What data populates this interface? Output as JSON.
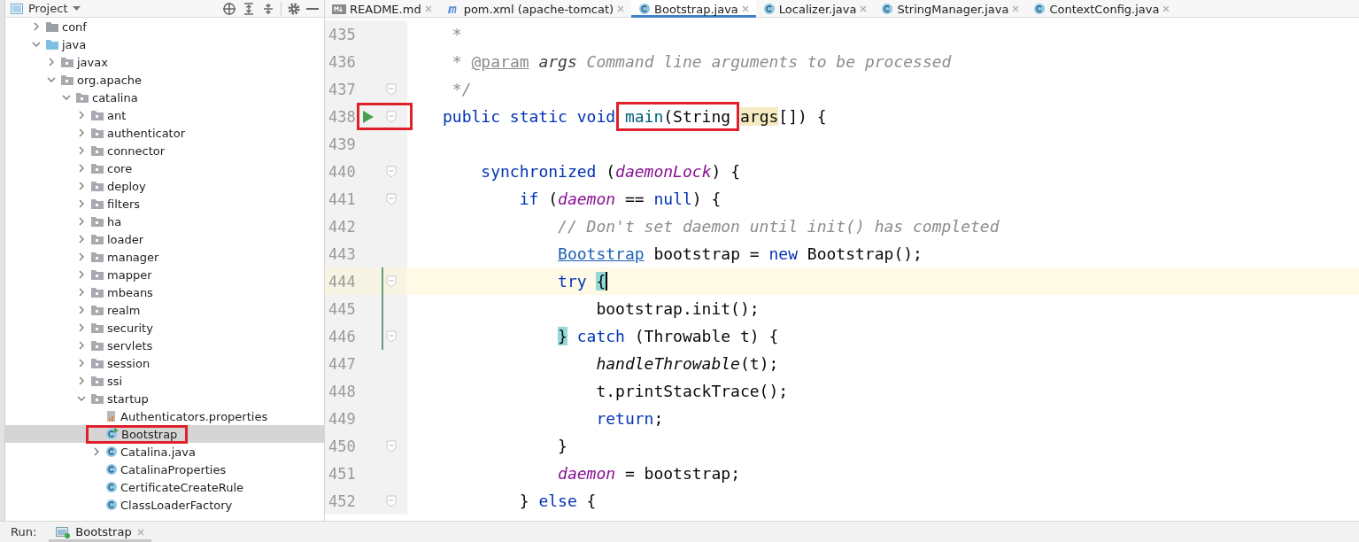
{
  "project_panel": {
    "title": "Project"
  },
  "tree": [
    {
      "label": "conf",
      "kind": "folder",
      "expanded": false
    },
    {
      "label": "java",
      "kind": "source-folder",
      "expanded": true,
      "children": [
        {
          "label": "javax",
          "kind": "package",
          "expanded": false
        },
        {
          "label": "org.apache",
          "kind": "package",
          "expanded": true,
          "children": [
            {
              "label": "catalina",
              "kind": "package",
              "expanded": true,
              "children": [
                {
                  "label": "ant",
                  "kind": "package",
                  "expanded": false
                },
                {
                  "label": "authenticator",
                  "kind": "package",
                  "expanded": false
                },
                {
                  "label": "connector",
                  "kind": "package",
                  "expanded": false
                },
                {
                  "label": "core",
                  "kind": "package",
                  "expanded": false
                },
                {
                  "label": "deploy",
                  "kind": "package",
                  "expanded": false
                },
                {
                  "label": "filters",
                  "kind": "package",
                  "expanded": false
                },
                {
                  "label": "ha",
                  "kind": "package",
                  "expanded": false
                },
                {
                  "label": "loader",
                  "kind": "package",
                  "expanded": false
                },
                {
                  "label": "manager",
                  "kind": "package",
                  "expanded": false
                },
                {
                  "label": "mapper",
                  "kind": "package",
                  "expanded": false
                },
                {
                  "label": "mbeans",
                  "kind": "package",
                  "expanded": false
                },
                {
                  "label": "realm",
                  "kind": "package",
                  "expanded": false
                },
                {
                  "label": "security",
                  "kind": "package",
                  "expanded": false
                },
                {
                  "label": "servlets",
                  "kind": "package",
                  "expanded": false
                },
                {
                  "label": "session",
                  "kind": "package",
                  "expanded": false
                },
                {
                  "label": "ssi",
                  "kind": "package",
                  "expanded": false
                },
                {
                  "label": "startup",
                  "kind": "package",
                  "expanded": true,
                  "children": [
                    {
                      "label": "Authenticators.properties",
                      "kind": "properties"
                    },
                    {
                      "label": "Bootstrap",
                      "kind": "runnable-class",
                      "selected": true,
                      "boxed": true
                    },
                    {
                      "label": "Catalina.java",
                      "kind": "class",
                      "expanded": false
                    },
                    {
                      "label": "CatalinaProperties",
                      "kind": "class"
                    },
                    {
                      "label": "CertificateCreateRule",
                      "kind": "class"
                    },
                    {
                      "label": "ClassLoaderFactory",
                      "kind": "class"
                    }
                  ]
                }
              ]
            }
          ]
        }
      ]
    }
  ],
  "editor_tabs": [
    {
      "label": "README.md",
      "kind": "md",
      "selected": false
    },
    {
      "label": "pom.xml (apache-tomcat)",
      "kind": "maven",
      "selected": false
    },
    {
      "label": "Bootstrap.java",
      "kind": "class",
      "selected": true
    },
    {
      "label": "Localizer.java",
      "kind": "class",
      "selected": false
    },
    {
      "label": "StringManager.java",
      "kind": "class",
      "selected": false
    },
    {
      "label": "ContextConfig.java",
      "kind": "class",
      "selected": false
    }
  ],
  "code_lines": [
    {
      "number": "435",
      "tokens": [
        {
          "kind": "comment",
          "text": " *"
        }
      ]
    },
    {
      "number": "436",
      "tokens": [
        {
          "kind": "comment",
          "text": " * "
        },
        {
          "kind": "doctag",
          "text": "@param"
        },
        {
          "kind": "docparam",
          "text": " args"
        },
        {
          "kind": "comment",
          "text": " Command line arguments to be processed"
        }
      ]
    },
    {
      "number": "437",
      "fold": true,
      "tokens": [
        {
          "kind": "comment",
          "text": " */"
        }
      ]
    },
    {
      "number": "438",
      "fold": true,
      "run": true,
      "boxed": true,
      "tokens": [
        {
          "kind": "kw",
          "text": "public static void "
        },
        {
          "kind": "decl",
          "text": "main",
          "boxed": true
        },
        {
          "kind": "plain",
          "text": "(String",
          "boxed": true
        },
        {
          "kind": "param-hl",
          "text": " args"
        },
        {
          "kind": "plain",
          "text": "[]) {"
        }
      ]
    },
    {
      "number": "439"
    },
    {
      "number": "440",
      "fold": true,
      "tokens": [
        {
          "kind": "kw",
          "text": "    synchronized"
        },
        {
          "kind": "plain",
          "text": " ("
        },
        {
          "kind": "field",
          "text": "daemonLock"
        },
        {
          "kind": "plain",
          "text": ") {"
        }
      ]
    },
    {
      "number": "441",
      "fold": true,
      "tokens": [
        {
          "kind": "kw",
          "text": "        if"
        },
        {
          "kind": "plain",
          "text": " ("
        },
        {
          "kind": "field",
          "text": "daemon"
        },
        {
          "kind": "plain",
          "text": " == "
        },
        {
          "kind": "kw",
          "text": "null"
        },
        {
          "kind": "plain",
          "text": ") {"
        }
      ]
    },
    {
      "number": "442",
      "tokens": [
        {
          "kind": "comment",
          "text": "            // Don't set daemon until init() has completed"
        }
      ]
    },
    {
      "number": "443",
      "tokens": [
        {
          "kind": "link",
          "text": "            Bootstrap"
        },
        {
          "kind": "plain",
          "text": " bootstrap = "
        },
        {
          "kind": "kw",
          "text": "new"
        },
        {
          "kind": "plain",
          "text": " Bootstrap();"
        }
      ]
    },
    {
      "number": "444",
      "fold": true,
      "current": true,
      "changed": true,
      "tokens": [
        {
          "kind": "kw",
          "text": "            try"
        },
        {
          "kind": "brace-match",
          "text": " {",
          "caret": true
        }
      ]
    },
    {
      "number": "445",
      "changed": true,
      "tokens": [
        {
          "kind": "plain",
          "text": "                bootstrap.init();"
        }
      ]
    },
    {
      "number": "446",
      "fold": true,
      "changed": true,
      "tokens": [
        {
          "kind": "brace-match",
          "text": "            }"
        },
        {
          "kind": "kw",
          "text": " catch"
        },
        {
          "kind": "plain",
          "text": " (Throwable t) {"
        }
      ]
    },
    {
      "number": "447",
      "tokens": [
        {
          "kind": "static-call",
          "text": "                handleThrowable"
        },
        {
          "kind": "plain",
          "text": "(t);"
        }
      ]
    },
    {
      "number": "448",
      "tokens": [
        {
          "kind": "plain",
          "text": "                t.printStackTrace();"
        }
      ]
    },
    {
      "number": "449",
      "tokens": [
        {
          "kind": "kw",
          "text": "                return"
        },
        {
          "kind": "plain",
          "text": ";"
        }
      ]
    },
    {
      "number": "450",
      "fold": true,
      "tokens": [
        {
          "kind": "plain",
          "text": "            }"
        }
      ]
    },
    {
      "number": "451",
      "tokens": [
        {
          "kind": "field",
          "text": "            daemon"
        },
        {
          "kind": "plain",
          "text": " = bootstrap;"
        }
      ]
    },
    {
      "number": "452",
      "fold": true,
      "tokens": [
        {
          "kind": "plain",
          "text": "        } "
        },
        {
          "kind": "kw",
          "text": "else"
        },
        {
          "kind": "plain",
          "text": " {"
        }
      ]
    }
  ],
  "run_bar": {
    "label": "Run:",
    "tabs": [
      {
        "label": "Bootstrap",
        "selected": true
      }
    ]
  }
}
